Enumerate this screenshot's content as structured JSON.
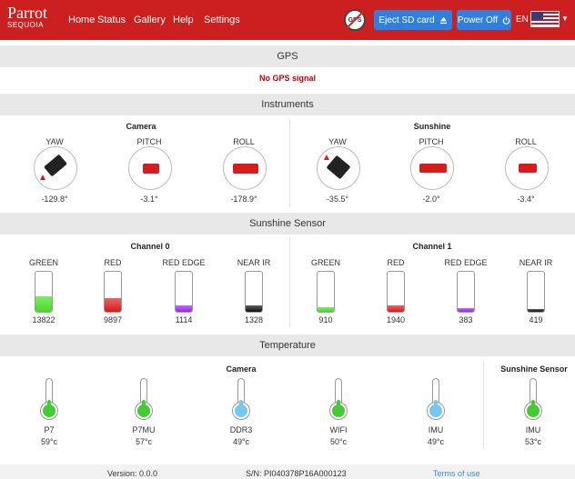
{
  "navbar": {
    "brand": "Parrot",
    "brand_sub": "SEQUOIA",
    "links": [
      "Home",
      "Status",
      "Gallery",
      "Help",
      "Settings"
    ],
    "gps_badge": "GPS",
    "eject_label": "Eject SD card",
    "power_label": "Power Off",
    "lang": "EN"
  },
  "gps": {
    "title": "GPS",
    "status": "No GPS signal"
  },
  "instruments": {
    "title": "Instruments",
    "camera": {
      "title": "Camera",
      "yaw": {
        "label": "YAW",
        "value": "-129.8°"
      },
      "pitch": {
        "label": "PITCH",
        "value": "-3.1°"
      },
      "roll": {
        "label": "ROLL",
        "value": "-178.9°"
      }
    },
    "sunshine": {
      "title": "Sunshine",
      "yaw": {
        "label": "YAW",
        "value": "-35.5°"
      },
      "pitch": {
        "label": "PITCH",
        "value": "-2.0°"
      },
      "roll": {
        "label": "ROLL",
        "value": "-3.4°"
      }
    }
  },
  "sunshine_sensor": {
    "title": "Sunshine Sensor",
    "channel0": {
      "title": "Channel 0",
      "bands": [
        {
          "label": "GREEN",
          "value": "13822",
          "level": 0.38,
          "color": "#44dd22"
        },
        {
          "label": "RED",
          "value": "9897",
          "level": 0.33,
          "color": "#d81b1b"
        },
        {
          "label": "RED EDGE",
          "value": "1114",
          "level": 0.16,
          "color": "#a020f0"
        },
        {
          "label": "NEAR IR",
          "value": "1328",
          "level": 0.16,
          "color": "#111111"
        }
      ]
    },
    "channel1": {
      "title": "Channel 1",
      "bands": [
        {
          "label": "GREEN",
          "value": "910",
          "level": 0.12,
          "color": "#44dd22"
        },
        {
          "label": "RED",
          "value": "1940",
          "level": 0.16,
          "color": "#d81b1b"
        },
        {
          "label": "RED EDGE",
          "value": "383",
          "level": 0.08,
          "color": "#a020f0"
        },
        {
          "label": "NEAR IR",
          "value": "419",
          "level": 0.07,
          "color": "#111111"
        }
      ]
    }
  },
  "temperature": {
    "title": "Temperature",
    "camera_title": "Camera",
    "sunshine_title": "Sunshine Sensor",
    "sensors": [
      {
        "name": "P7",
        "value": "59°c",
        "color": "#44cc33"
      },
      {
        "name": "P7MU",
        "value": "57°c",
        "color": "#44cc33"
      },
      {
        "name": "DDR3",
        "value": "49°c",
        "color": "#77c8f0"
      },
      {
        "name": "WIFI",
        "value": "50°c",
        "color": "#44cc33"
      },
      {
        "name": "IMU",
        "value": "49°c",
        "color": "#77c8f0"
      },
      {
        "name": "IMU",
        "value": "53°c",
        "color": "#44cc33"
      }
    ]
  },
  "footer": {
    "version": "Version: 0.0.0",
    "serial": "S/N: PI040378P16A000123",
    "terms": "Terms of use"
  }
}
